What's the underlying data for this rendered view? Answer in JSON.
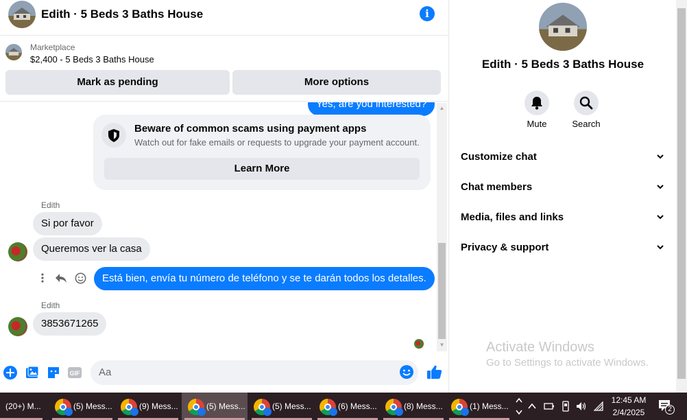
{
  "header": {
    "title": "Edith · 5 Beds 3 Baths House"
  },
  "marketplace": {
    "label": "Marketplace",
    "item": "$2,400 - 5 Beds 3 Baths House",
    "mark_pending": "Mark as pending",
    "more_options": "More options"
  },
  "messages": {
    "partial_outgoing": "Yes, are you interested?",
    "scam_title": "Beware of common scams using payment apps",
    "scam_sub": "Watch out for fake emails or requests to upgrade your payment account.",
    "learn_more": "Learn More",
    "sender_1": "Edith",
    "msg_1": "Si por favor",
    "msg_2": "Queremos ver la casa",
    "msg_3": "Está bien, envía tu número de teléfono y se te darán todos los detalles.",
    "sender_2": "Edith",
    "msg_4": "3853671265"
  },
  "composer": {
    "placeholder": "Aa"
  },
  "details": {
    "title": "Edith · 5 Beds 3 Baths House",
    "mute": "Mute",
    "search": "Search",
    "menu": [
      "Customize chat",
      "Chat members",
      "Media, files and links",
      "Privacy & support"
    ],
    "activate_1": "Activate Windows",
    "activate_2": "Go to Settings to activate Windows."
  },
  "taskbar": {
    "tabs": [
      "(20+) M...",
      "(5) Mess...",
      "(9) Mess...",
      "(5) Mess...",
      "(5) Mess...",
      "(6) Mess...",
      "(8) Mess...",
      "(1) Mess..."
    ],
    "time": "12:45 AM",
    "date": "2/4/2025",
    "notif_count": "2"
  },
  "colors": {
    "accent": "#0a7cff",
    "taskbar": "#2c1f23"
  }
}
